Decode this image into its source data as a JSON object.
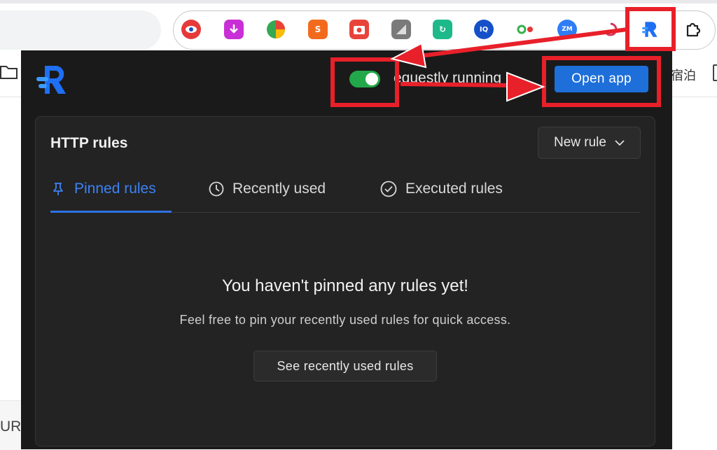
{
  "browser": {
    "extensions": [
      {
        "name": "eye-extension-icon",
        "color": "#e63a3a",
        "glyph": "👁"
      },
      {
        "name": "download-extension-icon",
        "color": "#c92fd6",
        "glyph": "↓"
      },
      {
        "name": "pie-extension-icon",
        "color": "#34a853",
        "glyph": ""
      },
      {
        "name": "s-extension-icon",
        "color": "#f26b1d",
        "glyph": "S"
      },
      {
        "name": "camera-extension-icon",
        "color": "#e8433a",
        "glyph": "◉"
      },
      {
        "name": "grey-extension-icon",
        "color": "#7a7a7a",
        "glyph": "◩"
      },
      {
        "name": "sync-extension-icon",
        "color": "#1db98a",
        "glyph": "↻"
      },
      {
        "name": "iq-extension-icon",
        "color": "#1650c8",
        "glyph": "IQ"
      },
      {
        "name": "nodes-extension-icon",
        "color": "#ffffff",
        "glyph": "✣"
      },
      {
        "name": "zm-extension-icon",
        "color": "#2f7df6",
        "glyph": "ZM"
      },
      {
        "name": "loop-extension-icon",
        "color": "#ffffff",
        "glyph": "∞"
      }
    ],
    "right_text": "宿泊",
    "left_bottom_text": "UR"
  },
  "popup": {
    "status_text": "equestly running",
    "open_app_label": "Open app",
    "toggle_on": true,
    "card": {
      "title": "HTTP rules",
      "new_rule_label": "New rule",
      "tabs": [
        {
          "label": "Pinned rules",
          "icon": "pin-icon",
          "active": true
        },
        {
          "label": "Recently used",
          "icon": "clock-icon",
          "active": false
        },
        {
          "label": "Executed rules",
          "icon": "check-circle-icon",
          "active": false
        }
      ],
      "empty_title": "You haven't pinned any rules yet!",
      "empty_subtitle": "Feel free to pin your recently used rules for quick access.",
      "see_recent_label": "See recently used rules"
    }
  },
  "colors": {
    "accent": "#1e6fd9",
    "toggle": "#22a84a",
    "annotation": "#e8202a",
    "popup_bg": "#1a1a1a"
  }
}
